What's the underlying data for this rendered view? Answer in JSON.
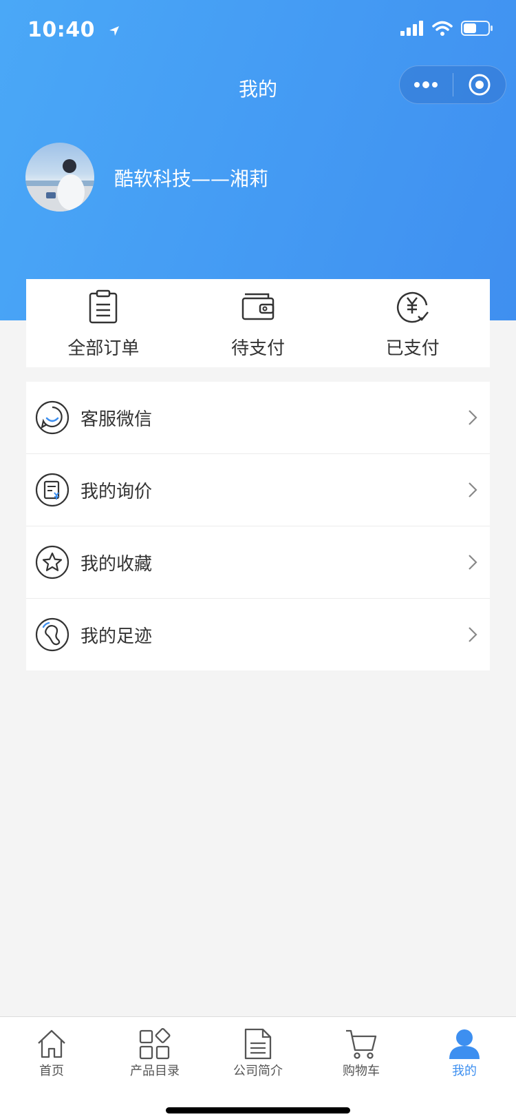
{
  "status_bar": {
    "time": "10:40"
  },
  "nav": {
    "title": "我的"
  },
  "profile": {
    "name": "酷软科技——湘莉"
  },
  "orders": [
    {
      "label": "全部订单",
      "icon": "clipboard-icon"
    },
    {
      "label": "待支付",
      "icon": "wallet-icon"
    },
    {
      "label": "已支付",
      "icon": "yen-check-icon"
    }
  ],
  "menu": [
    {
      "label": "客服微信",
      "icon": "chat-icon"
    },
    {
      "label": "我的询价",
      "icon": "inquiry-icon"
    },
    {
      "label": "我的收藏",
      "icon": "star-icon"
    },
    {
      "label": "我的足迹",
      "icon": "footprint-icon"
    }
  ],
  "tabbar": [
    {
      "label": "首页",
      "icon": "home-icon"
    },
    {
      "label": "产品目录",
      "icon": "catalog-icon"
    },
    {
      "label": "公司简介",
      "icon": "document-icon"
    },
    {
      "label": "购物车",
      "icon": "cart-icon"
    },
    {
      "label": "我的",
      "icon": "user-icon",
      "active": true
    }
  ],
  "colors": {
    "accent": "#3d8ff0",
    "header_gradient_start": "#4aa8f7",
    "header_gradient_end": "#3f8ff0"
  }
}
